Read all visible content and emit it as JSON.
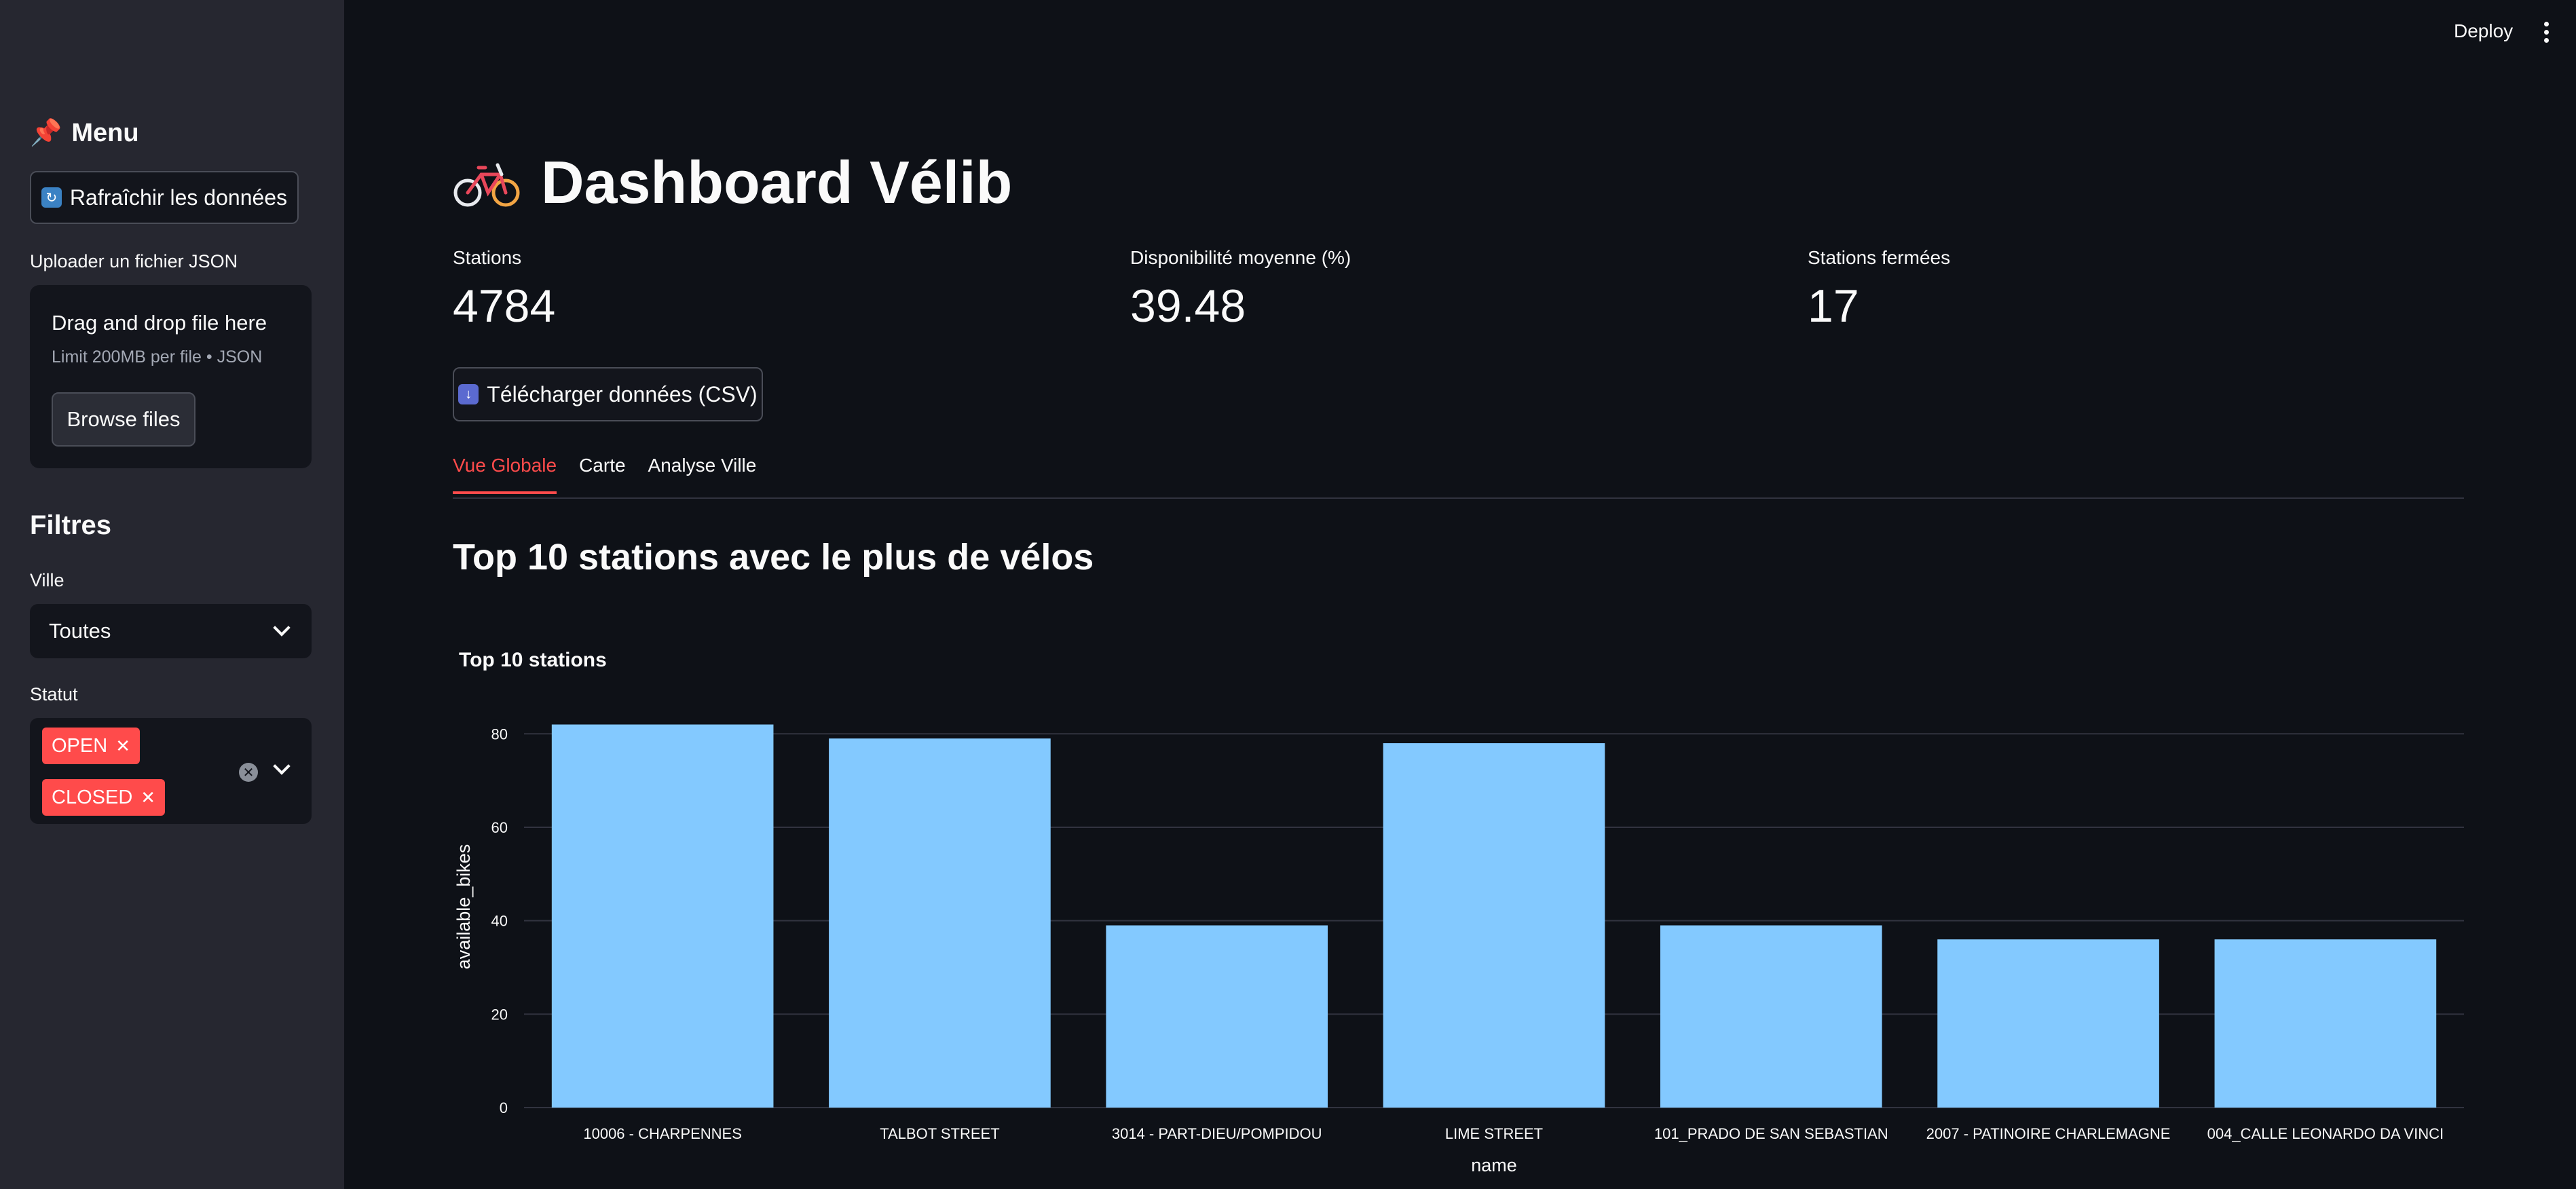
{
  "sidebar": {
    "title": "Menu",
    "refresh_button": "Rafraîchir les données",
    "upload_label": "Uploader un fichier JSON",
    "upload_drop_text": "Drag and drop file here",
    "upload_limit": "Limit 200MB per file • JSON",
    "browse_button": "Browse files",
    "filters_title": "Filtres",
    "city_label": "Ville",
    "city_value": "Toutes",
    "status_label": "Statut",
    "status_tags": [
      "OPEN",
      "CLOSED"
    ]
  },
  "topbar": {
    "deploy": "Deploy"
  },
  "main": {
    "title": "Dashboard Vélib",
    "metrics": [
      {
        "label": "Stations",
        "value": "4784"
      },
      {
        "label": "Disponibilité moyenne (%)",
        "value": "39.48"
      },
      {
        "label": "Stations fermées",
        "value": "17"
      }
    ],
    "download_button": "Télécharger données (CSV)",
    "tabs": [
      "Vue Globale",
      "Carte",
      "Analyse Ville"
    ],
    "active_tab": "Vue Globale",
    "section_title": "Top 10 stations avec le plus de vélos"
  },
  "colors": {
    "accent": "#ff4b4b",
    "bar": "#83c9ff",
    "background": "#0e1117",
    "sidebar": "#262730"
  },
  "chart_data": {
    "type": "bar",
    "title": "Top 10 stations",
    "xlabel": "name",
    "ylabel": "available_bikes",
    "categories": [
      "10006 - CHARPENNES",
      "TALBOT STREET",
      "3014 - PART-DIEU/POMPIDOU",
      "LIME STREET",
      "101_PRADO DE SAN SEBASTIAN",
      "2007 - PATINOIRE CHARLEMAGNE",
      "004_CALLE LEONARDO DA VINCI"
    ],
    "values": [
      82,
      79,
      39,
      78,
      39,
      36,
      36
    ],
    "yticks": [
      0,
      20,
      40,
      60,
      80
    ],
    "ylim": [
      0,
      86
    ],
    "grid": true
  }
}
